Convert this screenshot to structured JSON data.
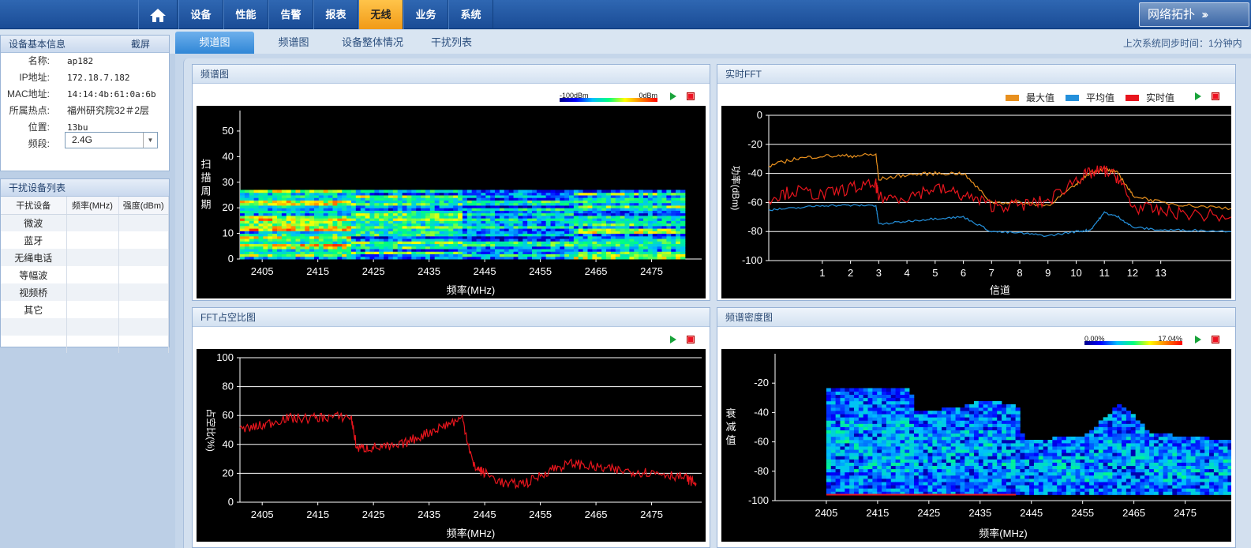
{
  "topnav": {
    "home_icon": "home-icon",
    "items": [
      "设备",
      "性能",
      "告警",
      "报表",
      "无线",
      "业务",
      "系统"
    ],
    "active_index": 4,
    "topology_label": "网络拓扑"
  },
  "subnav": {
    "tabs": [
      "频道图",
      "频谱图",
      "设备整体情况",
      "干扰列表"
    ],
    "active_index": 0,
    "sync_label": "上次系统同步时间：1分钟内"
  },
  "device_info": {
    "title": "设备基本信息",
    "fullscreen_label": "截屏",
    "rows": [
      {
        "key": "名称:",
        "value": "ap182"
      },
      {
        "key": "IP地址:",
        "value": "172.18.7.182"
      },
      {
        "key": "MAC地址:",
        "value": "14:14:4b:61:0a:6b"
      },
      {
        "key": "所属热点:",
        "value": "福州研究院32＃2层"
      },
      {
        "key": "位置:",
        "value": "13bu"
      }
    ],
    "band_label": "频段:",
    "band_value": "2.4G"
  },
  "interference": {
    "title": "干扰设备列表",
    "headers": [
      "干扰设备",
      "频率(MHz)",
      "强度(dBm)"
    ],
    "rows": [
      "微波",
      "蓝牙",
      "无绳电话",
      "等幅波",
      "视频桥",
      "其它",
      "",
      ""
    ]
  },
  "panels": {
    "waterfall": {
      "title": "频谱图",
      "colorbar_min": "-100dBm",
      "colorbar_max": "0dBm"
    },
    "fft": {
      "title": "实时FFT"
    },
    "duty": {
      "title": "FFT占空比图"
    },
    "density": {
      "title": "频谱密度图",
      "colorbar_min": "0.00%",
      "colorbar_max": "17.04%"
    }
  },
  "chart_data": [
    {
      "type": "heatmap",
      "title": "频谱图",
      "xlabel": "频率(MHz)",
      "ylabel": "扫描周期",
      "x_ticks": [
        2405,
        2415,
        2425,
        2435,
        2445,
        2455,
        2465,
        2475
      ],
      "y_ticks": [
        0,
        10,
        20,
        30,
        40,
        50
      ],
      "xlim": [
        2401,
        2484
      ],
      "ylim": [
        0,
        58
      ],
      "data_rows": 27,
      "segments": [
        {
          "x_start": 2401,
          "x_end": 2421,
          "base_level": 0.55
        },
        {
          "x_start": 2421,
          "x_end": 2441,
          "base_level": 0.42
        },
        {
          "x_start": 2441,
          "x_end": 2461,
          "base_level": 0.32
        },
        {
          "x_start": 2461,
          "x_end": 2481,
          "base_level": 0.45
        }
      ]
    },
    {
      "type": "line",
      "title": "实时FFT",
      "xlabel": "信道",
      "ylabel": "功率(dBm)",
      "x_ticks": [
        1,
        2,
        3,
        4,
        5,
        6,
        7,
        8,
        9,
        10,
        11,
        12,
        13
      ],
      "y_ticks": [
        0,
        -20,
        -40,
        -60,
        -80,
        -100
      ],
      "xlim": [
        -0.9,
        15.5
      ],
      "ylim": [
        -100,
        0
      ],
      "legend": [
        "最大值",
        "平均值",
        "实时值"
      ],
      "colors": {
        "最大值": "#e8901e",
        "平均值": "#2490db",
        "实时值": "#e8151d"
      },
      "series": [
        {
          "name": "最大值",
          "x": [
            -0.9,
            0,
            1,
            2,
            2.9,
            3,
            4,
            5,
            6,
            7,
            8,
            9,
            10,
            10.5,
            11,
            11.5,
            12,
            13,
            14,
            15.5
          ],
          "y": [
            -35,
            -30,
            -28,
            -28,
            -27,
            -44,
            -41,
            -40,
            -40,
            -60,
            -60,
            -62,
            -48,
            -39,
            -37,
            -40,
            -55,
            -60,
            -62,
            -64
          ]
        },
        {
          "name": "平均值",
          "x": [
            -0.9,
            0,
            1,
            2,
            2.9,
            3,
            4,
            5,
            6,
            7,
            8,
            9,
            10,
            10.5,
            11,
            11.5,
            12,
            13,
            14,
            15.5
          ],
          "y": [
            -65,
            -64,
            -62,
            -62,
            -62,
            -75,
            -73,
            -71,
            -70,
            -80,
            -81,
            -83,
            -80,
            -79,
            -67,
            -70,
            -77,
            -79,
            -79,
            -80
          ]
        },
        {
          "name": "实时值",
          "x": [
            -0.9,
            0,
            1,
            2,
            2.9,
            3,
            4,
            5,
            6,
            7,
            8,
            9,
            10,
            10.5,
            11,
            11.5,
            12,
            13,
            14,
            15.5
          ],
          "y": [
            -57,
            -52,
            -55,
            -50,
            -48,
            -57,
            -56,
            -50,
            -55,
            -62,
            -62,
            -59,
            -44,
            -40,
            -38,
            -43,
            -63,
            -66,
            -68,
            -70
          ]
        }
      ]
    },
    {
      "type": "line",
      "title": "FFT占空比图",
      "xlabel": "频率(MHz)",
      "ylabel": "占空比(%)",
      "x_ticks": [
        2405,
        2415,
        2425,
        2435,
        2445,
        2455,
        2465,
        2475
      ],
      "y_ticks": [
        0,
        20,
        40,
        60,
        80,
        100
      ],
      "xlim": [
        2401,
        2484
      ],
      "ylim": [
        0,
        100
      ],
      "series": [
        {
          "name": "",
          "x": [
            2401,
            2405,
            2409,
            2413,
            2417,
            2421,
            2422,
            2425,
            2429,
            2433,
            2437,
            2441,
            2443,
            2445,
            2449,
            2453,
            2457,
            2461,
            2465,
            2469,
            2473,
            2477,
            2481,
            2483
          ],
          "y": [
            50,
            53,
            58,
            58,
            59,
            59,
            37,
            38,
            38,
            45,
            52,
            58,
            25,
            20,
            12,
            14,
            23,
            27,
            24,
            22,
            21,
            20,
            17,
            13
          ]
        }
      ],
      "color": "#e8151d"
    },
    {
      "type": "heatmap",
      "title": "频谱密度图",
      "xlabel": "频率(MHz)",
      "ylabel": "衰减值",
      "x_ticks": [
        2405,
        2415,
        2425,
        2435,
        2445,
        2455,
        2465,
        2475
      ],
      "y_ticks": [
        -20,
        -40,
        -60,
        -80,
        -100
      ],
      "xlim": [
        2395,
        2484
      ],
      "ylim": [
        -100,
        0
      ],
      "envelope": [
        {
          "x": 2405,
          "top": -25,
          "bottom": -96
        },
        {
          "x": 2421,
          "top": -25,
          "bottom": -96
        },
        {
          "x": 2422,
          "top": -40,
          "bottom": -96
        },
        {
          "x": 2430,
          "top": -38,
          "bottom": -96
        },
        {
          "x": 2436,
          "top": -32,
          "bottom": -96
        },
        {
          "x": 2442,
          "top": -37,
          "bottom": -96
        },
        {
          "x": 2443,
          "top": -60,
          "bottom": -96
        },
        {
          "x": 2455,
          "top": -57,
          "bottom": -96
        },
        {
          "x": 2462,
          "top": -35,
          "bottom": -96
        },
        {
          "x": 2468,
          "top": -55,
          "bottom": -96
        },
        {
          "x": 2484,
          "top": -60,
          "bottom": -96
        }
      ]
    }
  ]
}
